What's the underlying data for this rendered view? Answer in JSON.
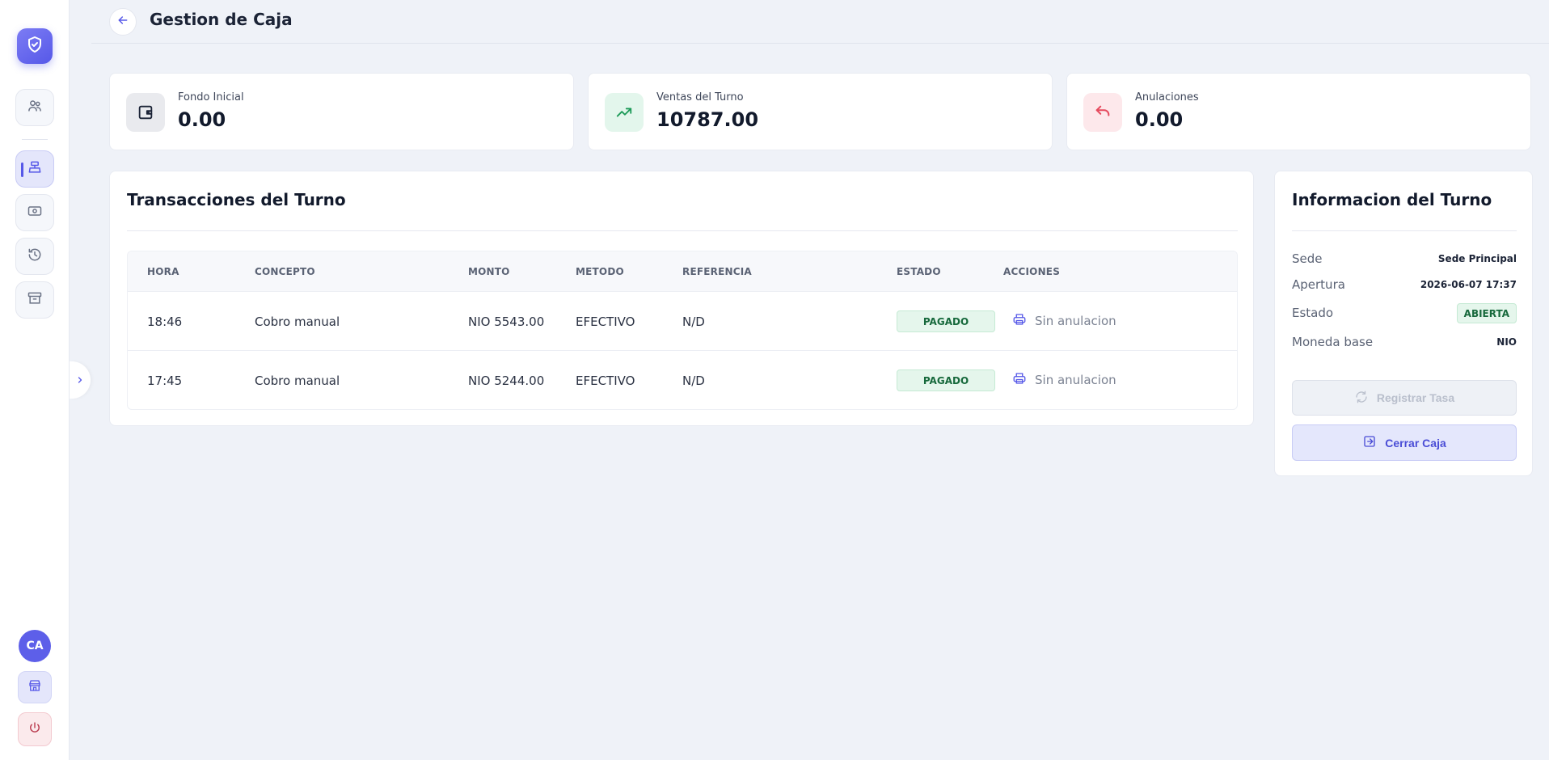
{
  "colors": {
    "accent": "#5658e8",
    "success": "#17693c",
    "danger": "#e64a5e",
    "background": "#eff2f8"
  },
  "sidebar": {
    "logo_icon": "shield-check-icon",
    "nav_items": [
      {
        "icon": "users-icon"
      },
      {
        "icon": "cash-register-icon",
        "active": true
      },
      {
        "icon": "banknote-icon"
      },
      {
        "icon": "history-icon"
      },
      {
        "icon": "archive-icon"
      }
    ],
    "toggle_icon": "chevron-right-icon",
    "avatar_initials": "CA",
    "store_icon": "store-icon",
    "power_icon": "power-icon"
  },
  "header": {
    "back_icon": "arrow-left-icon",
    "title": "Gestion de Caja"
  },
  "stats": [
    {
      "label": "Fondo Inicial",
      "value": "0.00",
      "icon": "wallet-icon"
    },
    {
      "label": "Ventas del Turno",
      "value": "10787.00",
      "icon": "trending-up-icon"
    },
    {
      "label": "Anulaciones",
      "value": "0.00",
      "icon": "undo-icon"
    }
  ],
  "transactions": {
    "title": "Transacciones del Turno",
    "columns": [
      "HORA",
      "CONCEPTO",
      "MONTO",
      "METODO",
      "REFERENCIA",
      "ESTADO",
      "ACCIONES"
    ],
    "rows": [
      {
        "hora": "18:46",
        "concepto": "Cobro manual",
        "monto": "NIO 5543.00",
        "metodo": "EFECTIVO",
        "referencia": "N/D",
        "estado": "PAGADO",
        "accion": "Sin anulacion"
      },
      {
        "hora": "17:45",
        "concepto": "Cobro manual",
        "monto": "NIO 5244.00",
        "metodo": "EFECTIVO",
        "referencia": "N/D",
        "estado": "PAGADO",
        "accion": "Sin anulacion"
      }
    ]
  },
  "info": {
    "title": "Informacion del Turno",
    "rows": [
      {
        "key": "Sede",
        "value": "Sede Principal"
      },
      {
        "key": "Apertura",
        "value": "2026-06-07 17:37"
      },
      {
        "key": "Estado",
        "value": "ABIERTA"
      },
      {
        "key": "Moneda base",
        "value": "NIO"
      }
    ],
    "register_rate_label": "Registrar Tasa",
    "close_label": "Cerrar Caja"
  }
}
